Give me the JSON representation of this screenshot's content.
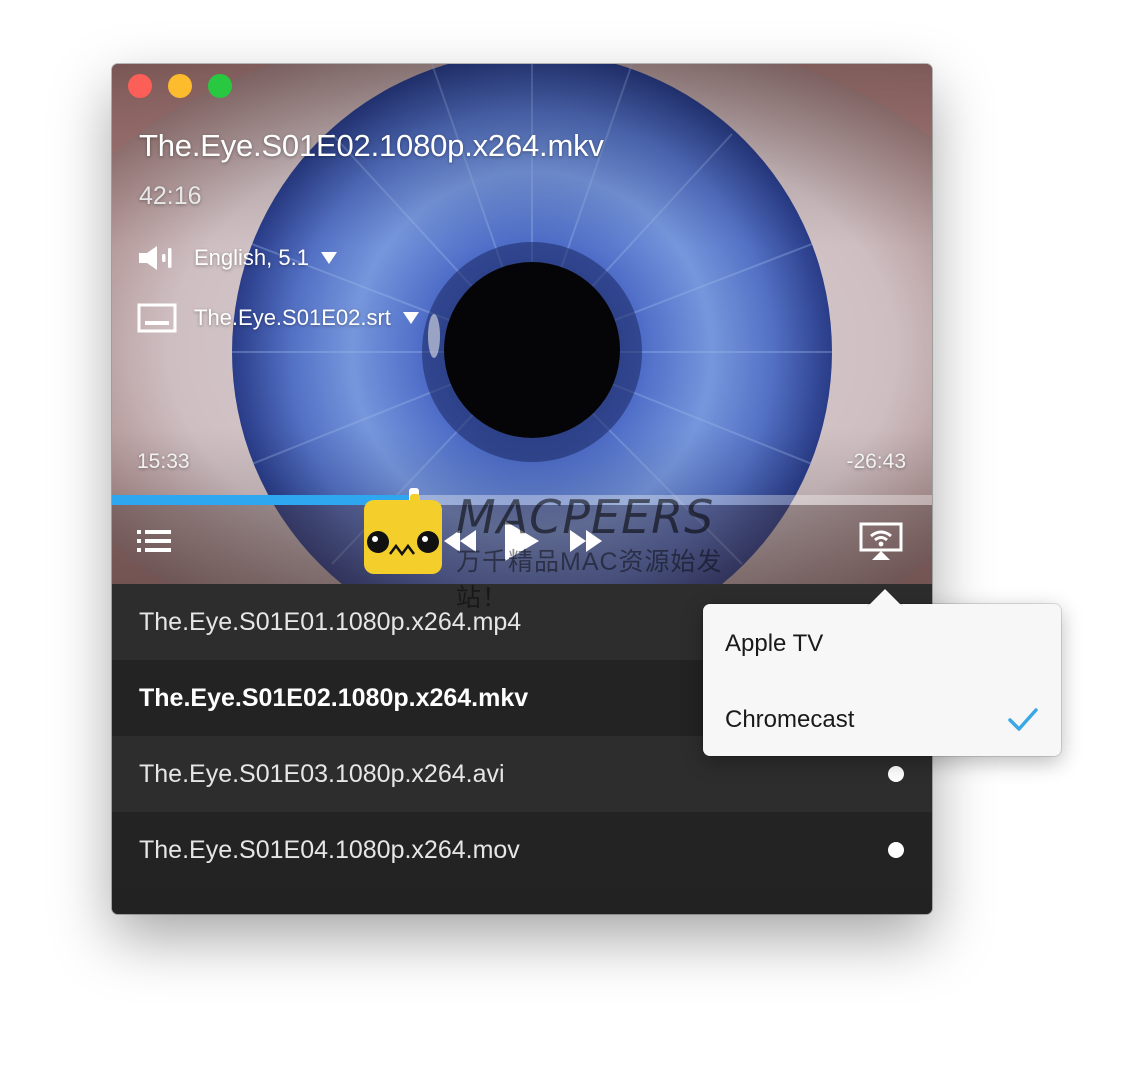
{
  "window": {
    "controls": {
      "close_icon": "close-traffic-light",
      "minimize_icon": "minimize-traffic-light",
      "zoom_icon": "zoom-traffic-light",
      "colors": {
        "close": "#fc5f57",
        "minimize": "#fdbc2e",
        "zoom": "#28c840"
      }
    }
  },
  "player": {
    "title": "The.Eye.S01E02.1080p.x264.mkv",
    "duration": "42:16",
    "audio_track": {
      "icon": "speaker-icon",
      "label": "English, 5.1"
    },
    "subtitle_track": {
      "icon": "subtitles-icon",
      "label": "The.Eye.S01E02.srt"
    },
    "time_elapsed": "15:33",
    "time_remaining": "-26:43",
    "progress_fraction": 0.368,
    "accent_color": "#2fa6f0",
    "controls": {
      "playlist_icon": "list-icon",
      "rewind_icon": "rewind-icon",
      "play_icon": "play-icon",
      "fast_forward_icon": "fast-forward-icon",
      "cast_icon": "airplay-icon"
    }
  },
  "playlist": {
    "items": [
      {
        "name": "The.Eye.S01E01.1080p.x264.mp4",
        "current": false,
        "unwatched_dot": false
      },
      {
        "name": "The.Eye.S01E02.1080p.x264.mkv",
        "current": true,
        "unwatched_dot": false
      },
      {
        "name": "The.Eye.S01E03.1080p.x264.avi",
        "current": false,
        "unwatched_dot": true
      },
      {
        "name": "The.Eye.S01E04.1080p.x264.mov",
        "current": false,
        "unwatched_dot": true
      }
    ]
  },
  "cast_menu": {
    "items": [
      {
        "label": "Apple TV",
        "selected": false
      },
      {
        "label": "Chromecast",
        "selected": true
      }
    ],
    "check_color": "#3ba8e6"
  },
  "watermark": {
    "logo": "MACPEERS",
    "subtitle": "万千精品MAC资源始发站！"
  }
}
